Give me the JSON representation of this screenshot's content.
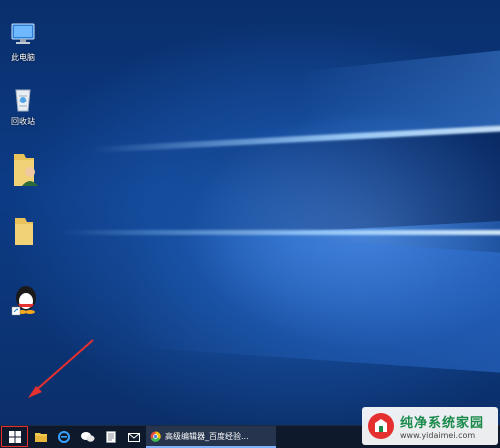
{
  "desktop": {
    "icons": [
      {
        "label": "此电脑",
        "icon": "this-pc-icon"
      },
      {
        "label": "回收站",
        "icon": "recycle-bin-icon"
      },
      {
        "label": "",
        "icon": "user-folder-icon"
      },
      {
        "label": "",
        "icon": "folder-icon"
      },
      {
        "label": "",
        "icon": "qq-icon"
      }
    ]
  },
  "taskbar": {
    "active_window_title": "高级编辑器_百度经验...",
    "items": [
      "start",
      "file-explorer",
      "internet-explorer",
      "wechat",
      "notepad",
      "mail",
      "browser"
    ]
  },
  "watermark": {
    "title": "纯净系统家园",
    "url": "www.yidaimei.com"
  },
  "colors": {
    "annotation_red": "#e53030",
    "taskbar": "#0e1a2b"
  }
}
